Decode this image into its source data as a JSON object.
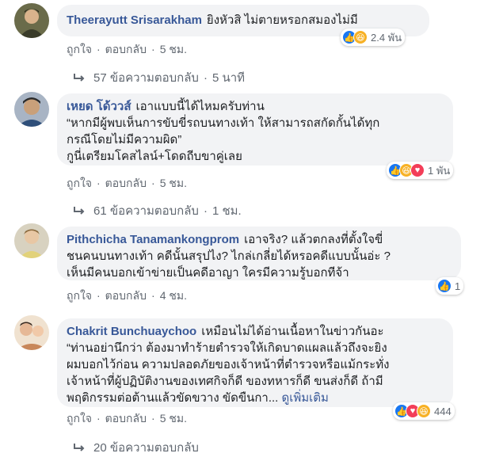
{
  "comments": [
    {
      "author": "Theerayutt Srisarakham",
      "text": "ยิงหัวสิ ไม่ตายหรอกสมองไม่มี",
      "reactions": [
        "like",
        "haha"
      ],
      "reaction_count": "2.4 พัน",
      "like_label": "ถูกใจ",
      "reply_label": "ตอบกลับ",
      "time": "5 ชม.",
      "replies_count_label": "57 ข้อความตอบกลับ",
      "replies_time": "5 นาที"
    },
    {
      "author": "เหยด โด้ววส์",
      "text_lines": [
        "เอาแบบนี้ได้ไหมครับท่าน",
        "“หากมีผู้พบเห็นการขับขี่รถบนทางเท้า ให้สามารถสกัดกั้นได้ทุก",
        "กรณีโดยไม่มีความผิด”",
        "กูนี่เตรียมโคสไลน์+โดดถีบขาคู่เลย"
      ],
      "reactions": [
        "like",
        "haha",
        "love"
      ],
      "reaction_count": "1 พัน",
      "like_label": "ถูกใจ",
      "reply_label": "ตอบกลับ",
      "time": "5 ชม.",
      "replies_count_label": "61 ข้อความตอบกลับ",
      "replies_time": "1 ชม."
    },
    {
      "author": "Pithchicha Tanamankongprom",
      "text_lines": [
        "เอาจริง? แล้วตกลงที่ตั้งใจขี่",
        "ชนคนบนทางเท้า คดีนั้นสรุปไง? ไกล่เกลี่ยได้หรอคดีแบบนั้นอ่ะ ?",
        "เห็นมีคนบอกเข้าข่ายเป็นคดีอาญา ใครมีความรู้บอกทีจ้า"
      ],
      "reactions": [
        "like"
      ],
      "reaction_count": "1",
      "like_label": "ถูกใจ",
      "reply_label": "ตอบกลับ",
      "time": "4 ชม."
    },
    {
      "author": "Chakrit Bunchuaychoo",
      "text_lines": [
        "เหมือนไม่ได้อ่านเนื้อหาในข่าวกันอะ",
        "“ท่านอย่านึกว่า ต้องมาทำร้ายตำรวจให้เกิดบาดแผลแล้วถึงจะยิง",
        "ผมบอกไว้ก่อน ความปลอดภัยของเจ้าหน้าที่ตำรวจหรือแม้กระทั่ง",
        "เจ้าหน้าที่ผู้ปฏิบัติงานของเทศกิจก็ดี ของทหารก็ดี ขนส่งก็ดี ถ้ามี",
        "พฤติกรรมต่อต้านแล้วขัดขวาง ขัดขืนกา..."
      ],
      "see_more": "ดูเพิ่มเติม",
      "reactions": [
        "like",
        "love",
        "haha"
      ],
      "reaction_count": "444",
      "like_label": "ถูกใจ",
      "reply_label": "ตอบกลับ",
      "time": "5 ชม.",
      "replies_count_label": "20 ข้อความตอบกลับ"
    }
  ],
  "separator": "·",
  "colors": {
    "author": "#385898",
    "bubble": "#f2f3f5",
    "meta": "#606770",
    "like": "#1877f2",
    "haha": "#f7b125",
    "love": "#f33e58"
  }
}
